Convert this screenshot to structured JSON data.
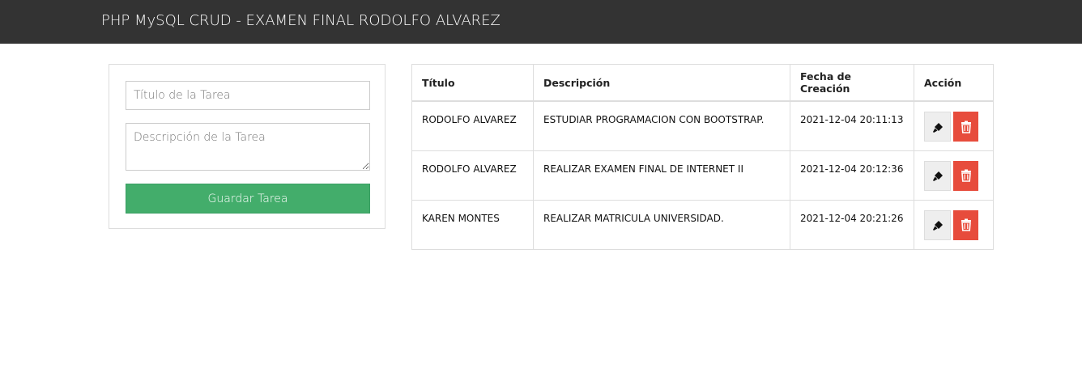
{
  "navbar": {
    "brand": "PHP MySQL CRUD - EXAMEN FINAL RODOLFO ALVAREZ"
  },
  "form": {
    "title_placeholder": "Título de la Tarea",
    "title_value": "",
    "description_placeholder": "Descripción de la Tarea",
    "description_value": "",
    "save_label": "Guardar Tarea"
  },
  "table": {
    "headers": [
      "Título",
      "Descripción",
      "Fecha de Creación",
      "Acción"
    ],
    "rows": [
      {
        "title": "RODOLFO ALVAREZ",
        "description": "ESTUDIAR PROGRAMACION CON BOOTSTRAP.",
        "created": "2021-12-04 20:11:13"
      },
      {
        "title": "RODOLFO ALVAREZ",
        "description": "REALIZAR EXAMEN FINAL DE INTERNET II",
        "created": "2021-12-04 20:12:36"
      },
      {
        "title": "KAREN MONTES",
        "description": "REALIZAR MATRICULA UNIVERSIDAD.",
        "created": "2021-12-04 20:21:26"
      }
    ]
  },
  "icons": {
    "edit": "marker-icon",
    "delete": "trash-icon"
  },
  "colors": {
    "navbar": "#333333",
    "save_button": "#43ad6b",
    "delete_button": "#e74c3c",
    "edit_button": "#eeeeee"
  }
}
